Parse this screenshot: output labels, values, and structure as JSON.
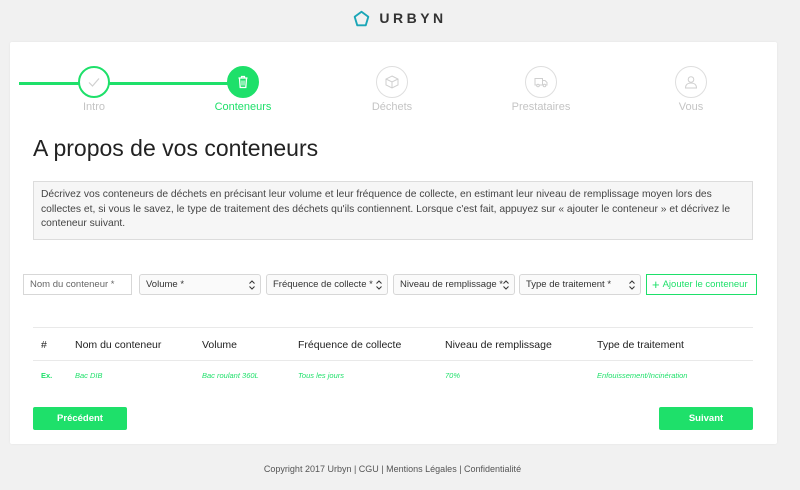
{
  "brand": {
    "name": "URBYN",
    "accent": "#1ee06a",
    "logo_color": "#1aa6b7",
    "icon": "pentagon-icon"
  },
  "stepper": {
    "steps": [
      {
        "label": "Intro",
        "icon": "check-icon",
        "state": "done"
      },
      {
        "label": "Conteneurs",
        "icon": "trash-icon",
        "state": "active"
      },
      {
        "label": "Déchets",
        "icon": "box-icon",
        "state": "pending"
      },
      {
        "label": "Prestataires",
        "icon": "truck-icon",
        "state": "pending"
      },
      {
        "label": "Vous",
        "icon": "user-icon",
        "state": "pending"
      }
    ]
  },
  "page": {
    "title": "A propos de vos conteneurs",
    "description": "Décrivez vos conteneurs de déchets en précisant leur volume et leur fréquence de collecte, en estimant leur niveau de remplissage moyen lors des collectes et, si vous le savez, le type de traitement des déchets qu'ils contiennent. Lorsque c'est fait, appuyez sur « ajouter le conteneur » et décrivez le conteneur suivant."
  },
  "form": {
    "name_placeholder": "Nom du conteneur *",
    "volume": "Volume *",
    "frequency": "Fréquence de collecte *",
    "fill_level": "Niveau de remplissage *",
    "treatment": "Type de traitement *",
    "add_button": "Ajouter le conteneur"
  },
  "table": {
    "headers": [
      "#",
      "Nom du conteneur",
      "Volume",
      "Fréquence de collecte",
      "Niveau de remplissage",
      "Type de traitement"
    ],
    "rows": [
      [
        "Ex.",
        "Bac DIB",
        "Bac roulant 360L",
        "Tous les jours",
        "70%",
        "Enfouissement/Incinération"
      ]
    ]
  },
  "nav": {
    "previous": "Précédent",
    "next": "Suivant"
  },
  "footer": {
    "text": "Copyright 2017 Urbyn | CGU | Mentions Légales | Confidentialité"
  }
}
